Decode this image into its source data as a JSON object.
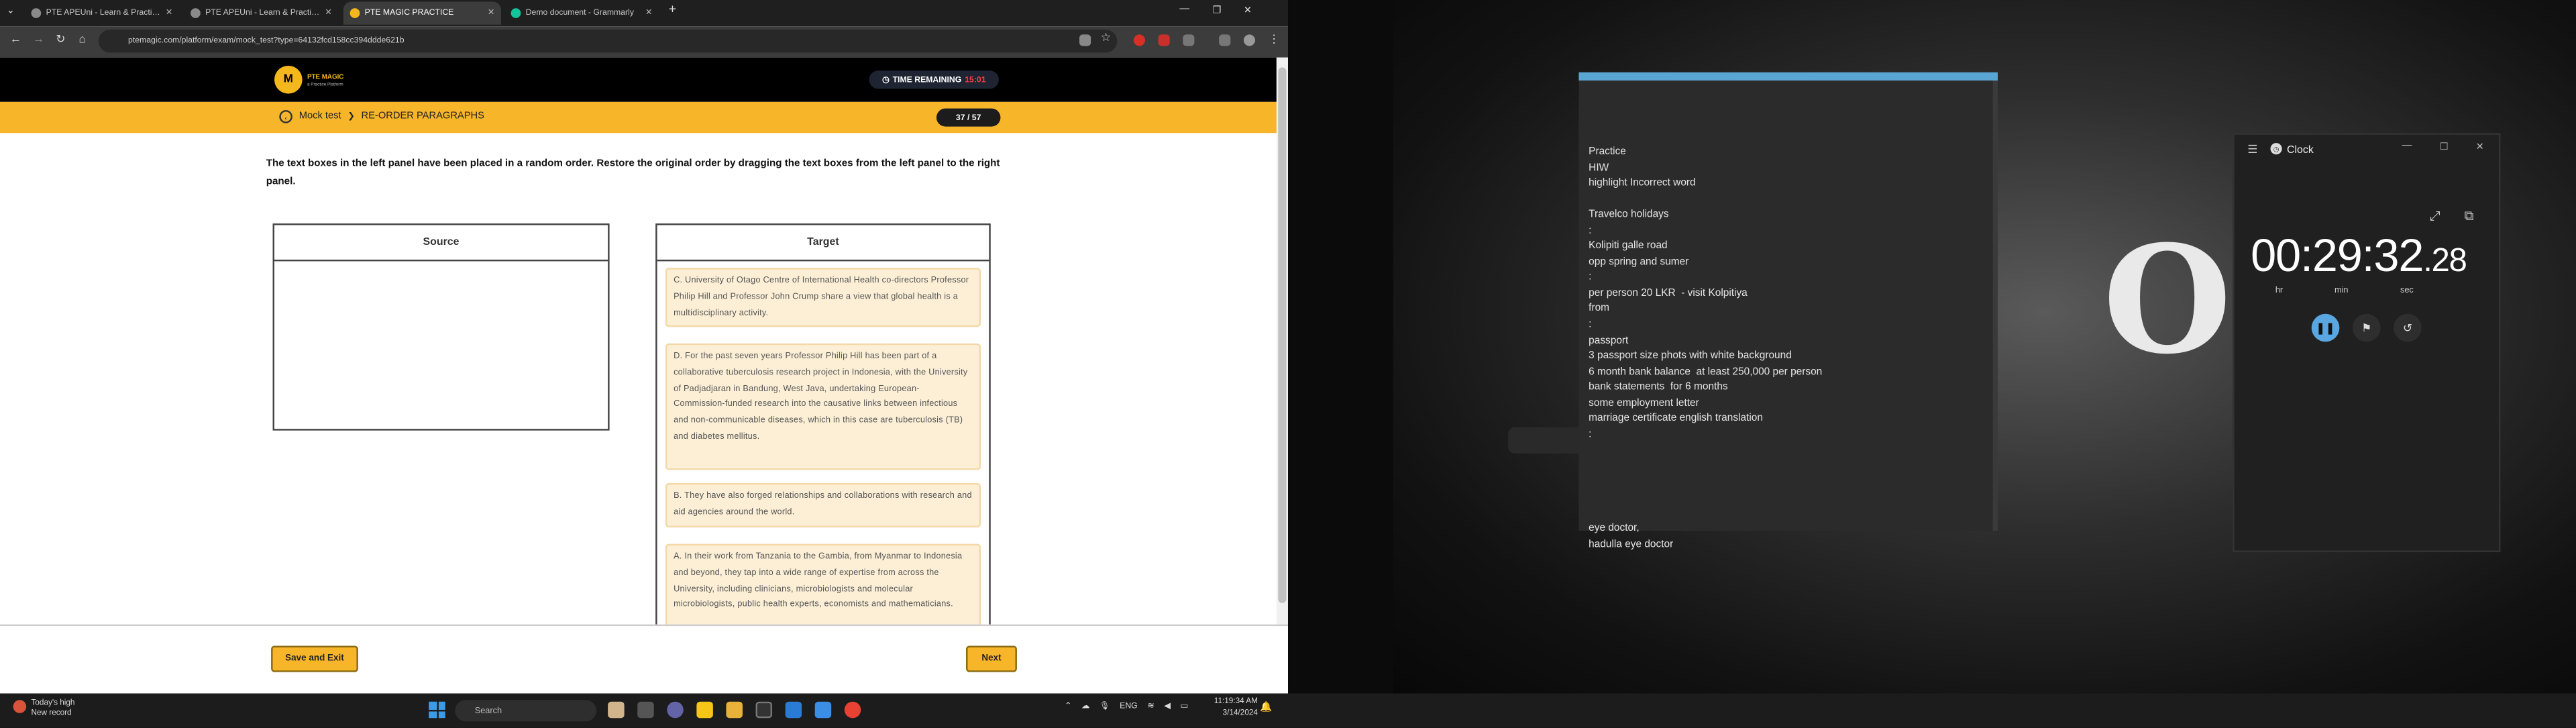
{
  "browser": {
    "tabs": [
      {
        "label": "PTE APEUni - Learn & Practice PT",
        "color": "#5f6368",
        "active": false
      },
      {
        "label": "PTE APEUni - Learn & Practice PT",
        "color": "#5f6368",
        "active": false
      },
      {
        "label": "PTE MAGIC PRACTICE",
        "color": "#f5b81c",
        "active": true
      },
      {
        "label": "Demo document - Grammarly",
        "color": "#15c39a",
        "active": false
      }
    ],
    "url": "ptemagic.com/platform/exam/mock_test?type=64132fcd158cc394ddde621b"
  },
  "header": {
    "logo_text": "PTE MAGIC",
    "logo_sub": "a Practice Platform",
    "logo_mark": "M",
    "timer_label": "TIME REMAINING",
    "timer_value": "15:01"
  },
  "crumb": {
    "section": "Mock test",
    "separator": "❯",
    "task": "RE-ORDER PARAGRAPHS",
    "counter": "37 / 57"
  },
  "question": {
    "instructions": "The text boxes in the left panel have been placed in a random order. Restore the original order by dragging the text boxes from the left panel to the right panel.",
    "source_title": "Source",
    "target_title": "Target",
    "target_cards": [
      "C. University of Otago Centre of International Health co-directors Professor Philip Hill and Professor John Crump share a view that global health is a multidisciplinary activity.",
      "D. For the past seven years Professor Philip Hill has been part of a collaborative tuberculosis research project in Indonesia, with the University of Padjadjaran in Bandung, West Java, undertaking European- Commission-funded research into the causative links between infectious and non-communicable diseases, which in this case are tuberculosis (TB) and diabetes mellitus.",
      "B. They have also forged relationships and collaborations with research and aid agencies around the world.",
      "A. In their work from Tanzania to the Gambia, from Myanmar to Indonesia and beyond, they tap into a wide range of expertise from across the University, including clinicians, microbiologists and molecular microbiologists, public health experts, economists and mathematicians."
    ]
  },
  "footer": {
    "save_exit": "Save and Exit",
    "next": "Next"
  },
  "wallpaper_text": "ORI",
  "notes": {
    "lines": "Practice\nHIW\nhighlight Incorrect word\n\nTravelco holidays\n:\nKolipiti galle road\nopp spring and sumer\n:\nper person 20 LKR  - visit Kolpitiya\nfrom\n:\npassport\n3 passport size phots with white background\n6 month bank balance  at least 250,000 per person\nbank statements  for 6 months\nsome employment letter\nmarriage certificate english translation\n:\n\n\n\n\n\neye doctor,\nhadulla eye doctor"
  },
  "clock_app": {
    "title": "Clock",
    "time_main": "00:29:32",
    "time_cs": ".28",
    "label_hr": "hr",
    "label_min": "min",
    "label_sec": "sec"
  },
  "taskbar": {
    "weather_line1": "Today's high",
    "weather_line2": "New record",
    "search_placeholder": "Search",
    "lang": "ENG",
    "time": "11:19:34 AM",
    "date": "3/14/2024"
  }
}
